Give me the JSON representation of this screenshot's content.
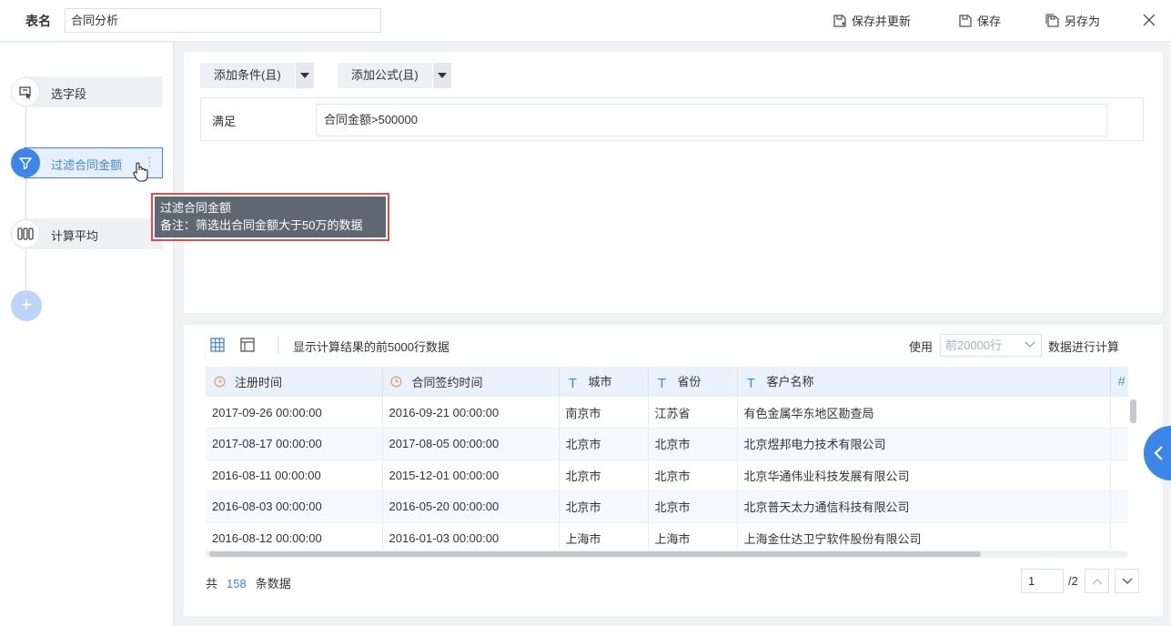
{
  "header": {
    "name_label": "表名",
    "name_value": "合同分析",
    "save_update_label": "保存并更新",
    "save_label": "保存",
    "save_as_label": "另存为"
  },
  "steps": [
    {
      "label": "选字段",
      "icon": "select-field-icon"
    },
    {
      "label": "过滤合同金额",
      "icon": "filter-icon"
    },
    {
      "label": "计算平均",
      "icon": "group-summary-icon"
    }
  ],
  "tooltip": {
    "title": "过滤合同金额",
    "note": "备注：筛选出合同金额大于50万的数据"
  },
  "filter": {
    "add_condition_label": "添加条件(且)",
    "add_formula_label": "添加公式(且)",
    "satisfy_label": "满足",
    "condition_value": "合同金额>500000"
  },
  "result": {
    "preview_note": "显示计算结果的前5000行数据",
    "use_label": "使用",
    "rows_option": "前20000行",
    "calc_label": "数据进行计算",
    "columns": [
      {
        "type_icon": "clock-icon",
        "label": "注册时间"
      },
      {
        "type_icon": "clock-icon",
        "label": "合同签约时间"
      },
      {
        "type_icon": "text-type-icon",
        "label": "城市"
      },
      {
        "type_icon": "text-type-icon",
        "label": "省份"
      },
      {
        "type_icon": "text-type-icon",
        "label": "客户名称"
      },
      {
        "type_icon": "number-type-icon",
        "label": "#"
      }
    ],
    "rows": [
      [
        "2017-09-26 00:00:00",
        "2016-09-21 00:00:00",
        "南京市",
        "江苏省",
        "有色金属华东地区勘查局"
      ],
      [
        "2017-08-17 00:00:00",
        "2017-08-05 00:00:00",
        "北京市",
        "北京市",
        "北京煜邦电力技术有限公司"
      ],
      [
        "2016-08-11 00:00:00",
        "2015-12-01 00:00:00",
        "北京市",
        "北京市",
        "北京华通伟业科技发展有限公司"
      ],
      [
        "2016-08-03 00:00:00",
        "2016-05-20 00:00:00",
        "北京市",
        "北京市",
        "北京普天太力通信科技有限公司"
      ],
      [
        "2016-08-12 00:00:00",
        "2016-01-03 00:00:00",
        "上海市",
        "上海市",
        "上海金仕达卫宁软件股份有限公司"
      ]
    ],
    "total_prefix": "共",
    "total_count": "158",
    "total_suffix": "条数据",
    "page_current": "1",
    "page_total": "/2"
  },
  "colors": {
    "accent": "#3d86e8",
    "tooltip_bg": "#5f6872",
    "highlight_border": "#e74c4c"
  }
}
